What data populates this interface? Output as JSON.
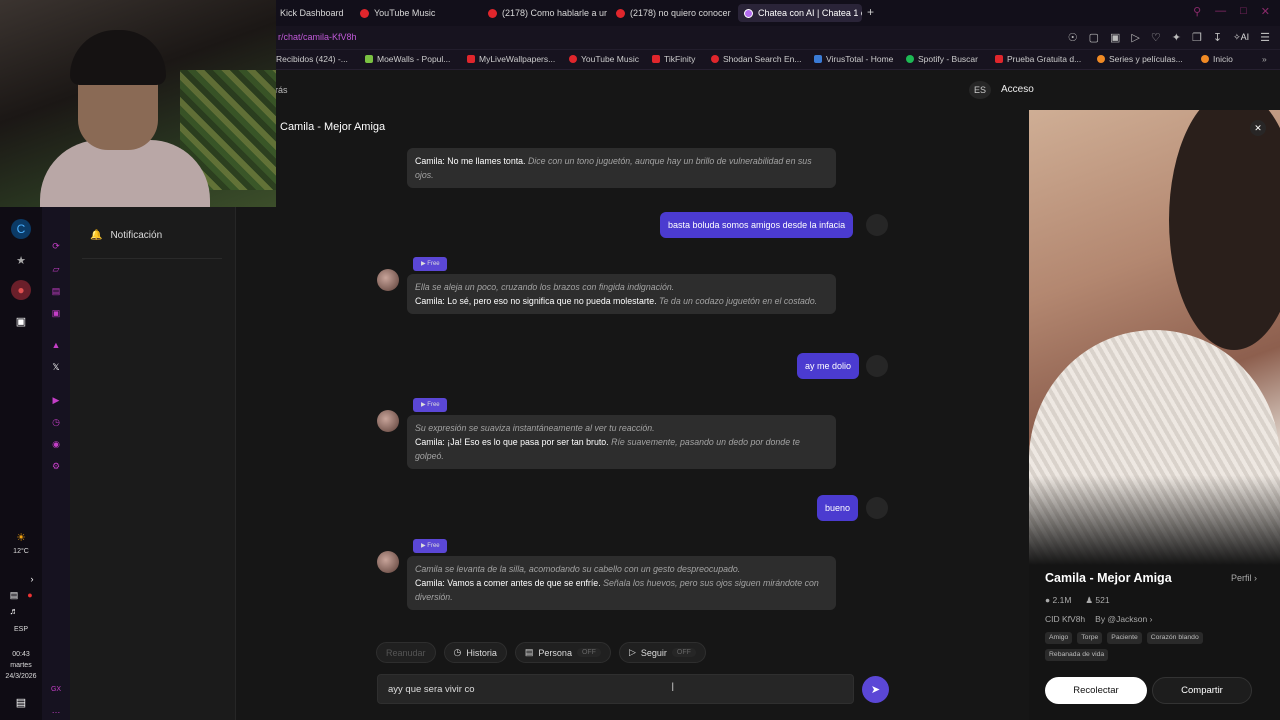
{
  "browser": {
    "tabs": [
      {
        "label": "Kick Dashboard",
        "icon": "kick-icon"
      },
      {
        "label": "YouTube Music",
        "icon": "youtube-music-icon"
      },
      {
        "label": "(2178) Como hablarle a ur",
        "icon": "youtube-icon"
      },
      {
        "label": "(2178) no quiero conocer",
        "icon": "youtube-icon"
      },
      {
        "label": "Chatea con AI | Chatea 1 c",
        "icon": "ai-chat-icon"
      }
    ],
    "new_tab": "+",
    "url": "r/chat/camila-KfV8h",
    "ai_label": "AI",
    "bookmarks": [
      {
        "label": "Recibidos (424) -...",
        "icon": "gmail-icon",
        "color": "#d93025"
      },
      {
        "label": "MoeWalls - Popul...",
        "icon": "moewalls-icon",
        "color": "#7ac142"
      },
      {
        "label": "MyLiveWallpapers...",
        "icon": "mylivewallpapers-icon",
        "color": "#e0262c"
      },
      {
        "label": "YouTube Music",
        "icon": "youtube-music-icon",
        "color": "#e0262c"
      },
      {
        "label": "TikFinity",
        "icon": "tikfinity-icon",
        "color": "#e0262c"
      },
      {
        "label": "Shodan Search En...",
        "icon": "shodan-icon",
        "color": "#e0262c"
      },
      {
        "label": "VirusTotal - Home",
        "icon": "virustotal-icon",
        "color": "#3a7bd5"
      },
      {
        "label": "Spotify - Buscar",
        "icon": "spotify-icon",
        "color": "#1db954"
      },
      {
        "label": "Prueba Gratuita d...",
        "icon": "trial-icon",
        "color": "#e0262c"
      },
      {
        "label": "Series y películas...",
        "icon": "series-icon",
        "color": "#f08a24"
      },
      {
        "label": "Inicio",
        "icon": "home-icon",
        "color": "#f08a24"
      }
    ]
  },
  "system": {
    "temperature": "12°C",
    "language": "ESP",
    "time": "00:43",
    "day": "martes",
    "date": "24/3/2026"
  },
  "sidebar": {
    "notification_label": "Notificación"
  },
  "header": {
    "back_label": "rás",
    "lang": "ES",
    "login": "Acceso"
  },
  "chat": {
    "title": "Camila - Mejor Amiga",
    "free_tag": "Free",
    "messages": [
      {
        "role": "ai",
        "narration_before": "",
        "speech": "Camila: No me llames tonta.",
        "narration_after": " Dice con un tono juguetón, aunque hay un brillo de vulnerabilidad en sus ojos."
      },
      {
        "role": "user",
        "text": "basta boluda somos amigos desde la infacia"
      },
      {
        "role": "ai",
        "narration_before": "Ella se aleja un poco, cruzando los brazos con fingida indignación.",
        "speech": "Camila: Lo sé, pero eso no significa que no pueda molestarte.",
        "narration_after": " Te da un codazo juguetón en el costado."
      },
      {
        "role": "user",
        "text": "ay me dolio"
      },
      {
        "role": "ai",
        "narration_before": "Su expresión se suaviza instantáneamente al ver tu reacción.",
        "speech": "Camila: ¡Ja! Eso es lo que pasa por ser tan bruto.",
        "narration_after": " Ríe suavemente, pasando un dedo por donde te golpeó."
      },
      {
        "role": "user",
        "text": "bueno"
      },
      {
        "role": "ai",
        "narration_before": "Camila se levanta de la silla, acomodando su cabello con un gesto despreocupado.",
        "speech": "Camila: Vamos a comer antes de que se enfríe.",
        "narration_after": " Señala los huevos, pero sus ojos siguen mirándote con diversión."
      }
    ],
    "actions": {
      "reanudar": "Reanudar",
      "historia": "Historia",
      "persona": "Persona",
      "persona_state": "OFF",
      "seguir": "Seguir",
      "seguir_state": "OFF"
    },
    "input_value": "ayy que sera vivir co"
  },
  "profile": {
    "name": "Camila - Mejor Amiga",
    "perfil_link": "Perfil",
    "chats": "2.1M",
    "followers": "521",
    "cid": "CID KfV8h",
    "author": "By @Jackson",
    "tags": [
      "Amigo",
      "Torpe",
      "Paciente",
      "Corazón blando",
      "Rebanada de vida"
    ],
    "recollect": "Recolectar",
    "share": "Compartir"
  }
}
